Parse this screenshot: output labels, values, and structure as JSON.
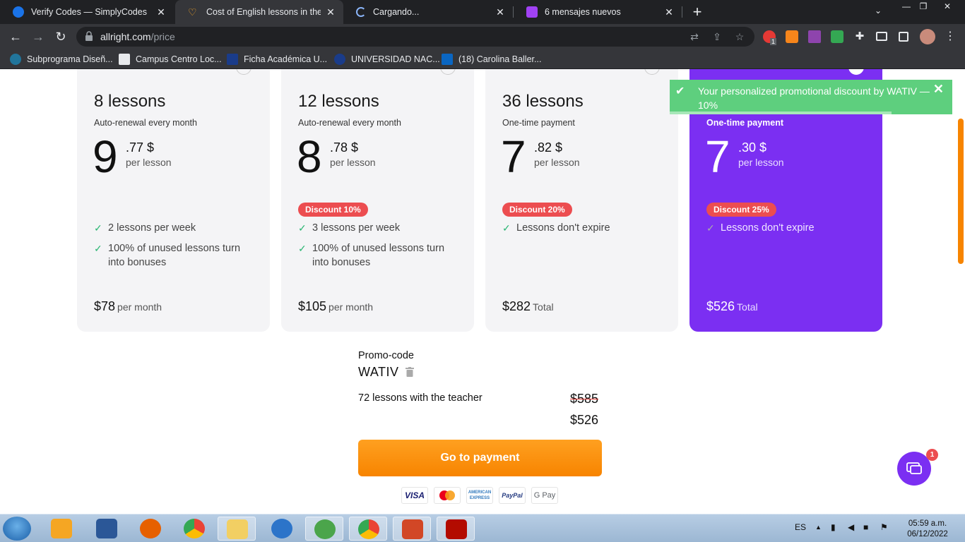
{
  "browser": {
    "tabs": [
      {
        "title": "Verify Codes — SimplyCodes",
        "active": false
      },
      {
        "title": "Cost of English lessons in the onl",
        "active": true
      },
      {
        "title": "Cargando...",
        "active": false
      },
      {
        "title": "6 mensajes nuevos",
        "active": false
      }
    ],
    "url": {
      "domain": "allright.com",
      "path": "/price"
    },
    "bookmarks": [
      {
        "label": "Subprograma Diseñ..."
      },
      {
        "label": "Campus Centro Loc..."
      },
      {
        "label": "Ficha Académica U..."
      },
      {
        "label": "UNIVERSIDAD NAC..."
      },
      {
        "label": "(18) Carolina Baller..."
      }
    ],
    "extension_badge": "1"
  },
  "plans": [
    {
      "lessons": "8 lessons",
      "renewal": "Auto-renewal every month",
      "whole": "9",
      "cents": ".77 $",
      "per_lesson": "per lesson",
      "discount": "",
      "features": [
        "2 lessons per week",
        "100% of unused lessons turn into bonuses"
      ],
      "price": "$78",
      "price_suffix": "per month",
      "featured": false
    },
    {
      "lessons": "12 lessons",
      "renewal": "Auto-renewal every month",
      "whole": "8",
      "cents": ".78 $",
      "per_lesson": "per lesson",
      "discount": "Discount 10%",
      "features": [
        "3 lessons per week",
        "100% of unused lessons turn into bonuses"
      ],
      "price": "$105",
      "price_suffix": "per month",
      "featured": false
    },
    {
      "lessons": "36 lessons",
      "renewal": "One-time payment",
      "whole": "7",
      "cents": ".82 $",
      "per_lesson": "per lesson",
      "discount": "Discount 20%",
      "features": [
        "Lessons don't expire"
      ],
      "price": "$282",
      "price_suffix": "Total",
      "featured": false
    },
    {
      "lessons": "",
      "renewal": "One-time payment",
      "whole": "7",
      "cents": ".30 $",
      "per_lesson": "per lesson",
      "discount": "Discount 25%",
      "features": [
        "Lessons don't expire"
      ],
      "price": "$526",
      "price_suffix": "Total",
      "featured": true
    }
  ],
  "promo": {
    "label": "Promo-code",
    "code": "WATIV"
  },
  "summary": {
    "label": "72 lessons with the teacher",
    "old_price": "$585",
    "new_price": "$526"
  },
  "pay_button": "Go to payment",
  "payment_methods": [
    "VISA",
    "",
    "AMERICAN EXPRESS",
    "PayPal",
    "G Pay"
  ],
  "toast": {
    "message": "Your personalized promotional discount by WATIV — 10%"
  },
  "chat": {
    "badge": "1"
  },
  "colors": {
    "brand_purple": "#7b2ff2",
    "accent_orange": "#f78400",
    "discount_red": "#ec4d50",
    "check_green": "#2bb673",
    "toast_green": "#5ecf7e"
  },
  "taskbar": {
    "language": "ES",
    "time": "05:59 a.m.",
    "date": "06/12/2022"
  }
}
